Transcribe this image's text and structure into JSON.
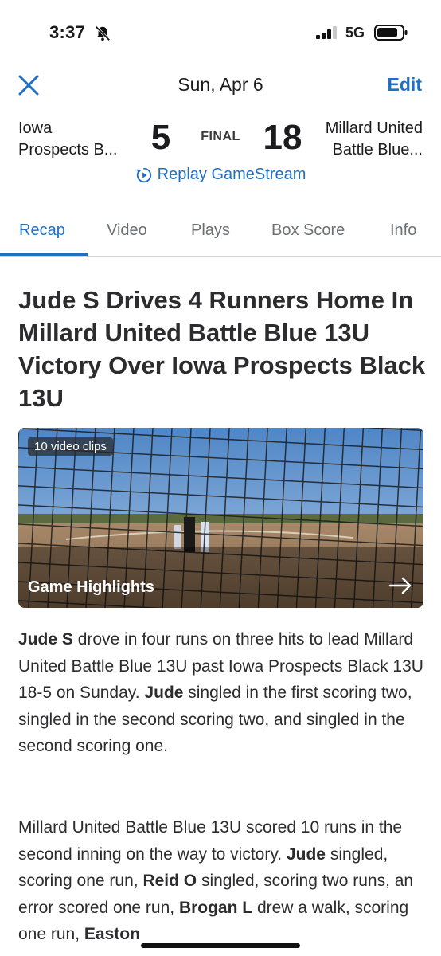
{
  "status_bar": {
    "time": "3:37",
    "network": "5G"
  },
  "header": {
    "date": "Sun, Apr 6",
    "edit_label": "Edit"
  },
  "score": {
    "home_team_line1": "Iowa",
    "home_team_line2": "Prospects B...",
    "home_score": "5",
    "status": "FINAL",
    "away_score": "18",
    "away_team_line1": "Millard United",
    "away_team_line2": "Battle Blue...",
    "replay_label": "Replay GameStream"
  },
  "tabs": [
    "Recap",
    "Video",
    "Plays",
    "Box Score",
    "Info"
  ],
  "article": {
    "headline": "Jude S Drives 4 Runners Home In Millard United Battle Blue 13U Victory Over Iowa Prospects Black 13U",
    "video": {
      "clips_label": "10 video clips",
      "title": "Game Highlights"
    },
    "p1": [
      {
        "t": "Jude S",
        "b": true
      },
      {
        "t": " drove in four runs on three hits to lead Millard United Battle Blue 13U past Iowa Prospects Black 13U 18-5 on Sunday. ",
        "b": false
      },
      {
        "t": "Jude",
        "b": true
      },
      {
        "t": " singled in the first scoring two, singled in the second scoring two, and singled in the second scoring one.",
        "b": false
      }
    ],
    "p2": [
      {
        "t": "Millard United Battle Blue 13U scored 10 runs in the second inning on the way to victory.  ",
        "b": false
      },
      {
        "t": "Jude",
        "b": true
      },
      {
        "t": " singled, scoring one run, ",
        "b": false
      },
      {
        "t": "Reid O",
        "b": true
      },
      {
        "t": " singled, scoring two runs, an error scored one run, ",
        "b": false
      },
      {
        "t": "Brogan L",
        "b": true
      },
      {
        "t": " drew a walk, scoring one run, ",
        "b": false
      },
      {
        "t": "Easton",
        "b": true
      }
    ]
  },
  "colors": {
    "accent": "#1f6fc5",
    "text": "#2c2c2e",
    "muted": "#6b7075"
  }
}
